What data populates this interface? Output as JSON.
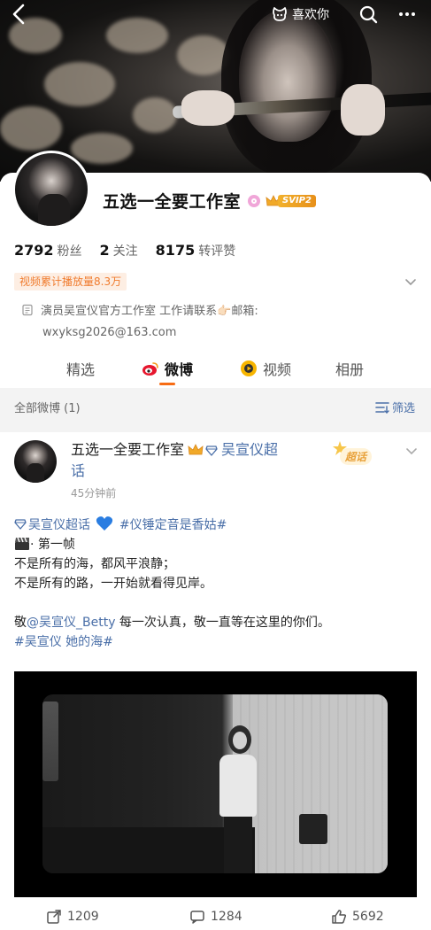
{
  "header": {
    "like_label": "喜欢你"
  },
  "profile": {
    "name": "五选一全要工作室",
    "svip_label": "SVIP2",
    "stats": [
      {
        "value": "2792",
        "label": "粉丝"
      },
      {
        "value": "2",
        "label": "关注"
      },
      {
        "value": "8175",
        "label": "转评赞"
      }
    ],
    "play_badge": "视频累计播放量8.3万",
    "bio_line1": "演员吴宣仪官方工作室 工作请联系👉🏻邮箱:",
    "bio_line2": "wxyksg2026@163.com"
  },
  "tabs": [
    {
      "label": "精选"
    },
    {
      "label": "微博"
    },
    {
      "label": "视频"
    },
    {
      "label": "相册"
    }
  ],
  "filter_bar": {
    "left_label": "全部微博 (1)",
    "right_label": "筛选"
  },
  "post": {
    "author": "五选一全要工作室",
    "supertopic": "吴宣仪超",
    "supertopic_cont": "话",
    "time": "45分钟前",
    "supertopic_btn": "超话",
    "line1_link1": "吴宣仪超话",
    "line1_link2": "#仪锤定音是香姑#",
    "line2": "· 第一帧",
    "line3": "不是所有的海，都风平浪静；",
    "line4": "不是所有的路，一开始就看得见岸。",
    "line6_prefix": "敬",
    "line6_mention": "@吴宣仪_Betty",
    "line6_suffix": " 每一次认真，敬一直等在这里的你们。",
    "line7_tag": "#吴宣仪 她的海#",
    "actions": [
      {
        "count": "1209"
      },
      {
        "count": "1284"
      },
      {
        "count": "5692"
      }
    ]
  },
  "colors": {
    "accent_orange": "#f76c14",
    "link_blue": "#4a6fa8",
    "badge_orange": "#f07b2d"
  }
}
